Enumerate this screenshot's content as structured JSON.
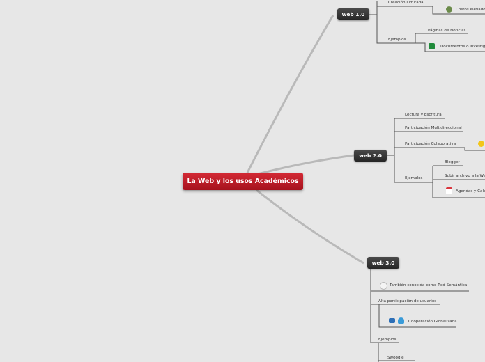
{
  "root": {
    "label": "La Web y los usos Académicos"
  },
  "web1": {
    "label": "web 1.0",
    "creacion": "Creación Limitada",
    "costos": "Costos elevados",
    "ejemplos": "Ejemplos",
    "paginas": "Páginas de Noticias",
    "documentos": "Documentos o investigaciones"
  },
  "web2": {
    "label": "web 2.0",
    "lectura": "Lectura y Escritura",
    "multi": "Participación Multidireccional",
    "colab": "Participación Colaborativa",
    "ejemplos": "Ejemplos",
    "blogger": "Blogger",
    "subir": "Subir archivo a la Web",
    "agendas": "Agendas y Calendarios"
  },
  "web3": {
    "label": "web 3.0",
    "semantica": "También conocida como Red Semántica",
    "alta": "Alta participación de usuarios",
    "cooperacion": "Cooperación Globalizada",
    "ejemplos": "Ejemplos",
    "swoogle": "Swoogle"
  },
  "icons": {
    "costos": "money-bag-icon",
    "documentos": "green-book-icon",
    "colab": "sunglasses-smiley-icon",
    "agendas": "calendar-icon",
    "semantica": "pie-chart-icon",
    "cooperacion": "people-computer-icon"
  }
}
